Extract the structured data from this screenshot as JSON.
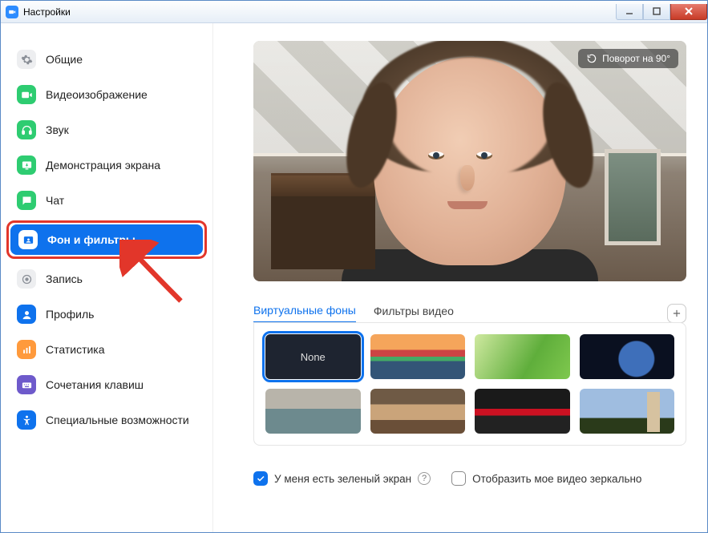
{
  "window": {
    "title": "Настройки"
  },
  "sidebar": {
    "items": [
      {
        "label": "Общие",
        "icon": "gear"
      },
      {
        "label": "Видеоизображение",
        "icon": "video"
      },
      {
        "label": "Звук",
        "icon": "audio"
      },
      {
        "label": "Демонстрация экрана",
        "icon": "screen"
      },
      {
        "label": "Чат",
        "icon": "chat"
      },
      {
        "label": "Фон и фильтры",
        "icon": "background",
        "active": true,
        "callout": true
      },
      {
        "label": "Запись",
        "icon": "record"
      },
      {
        "label": "Профиль",
        "icon": "profile"
      },
      {
        "label": "Статистика",
        "icon": "stats"
      },
      {
        "label": "Сочетания клавиш",
        "icon": "keyboard"
      },
      {
        "label": "Специальные возможности",
        "icon": "accessibility"
      }
    ]
  },
  "preview": {
    "rotate_label": "Поворот на 90°"
  },
  "tabs": {
    "virtual_bg": "Виртуальные фоны",
    "filters": "Фильтры видео"
  },
  "thumbs": {
    "none_label": "None",
    "items": [
      "none",
      "bridge",
      "grass",
      "earth",
      "lake",
      "loft",
      "arena",
      "tower"
    ]
  },
  "checks": {
    "green_screen": "У меня есть зеленый экран",
    "mirror": "Отобразить мое видео зеркально"
  }
}
